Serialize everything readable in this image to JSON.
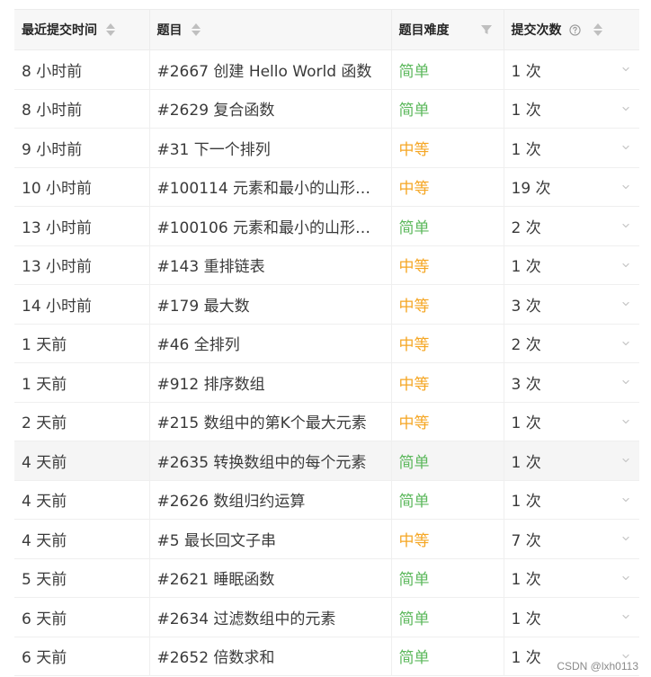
{
  "header": {
    "time": "最近提交时间",
    "title": "题目",
    "difficulty": "题目难度",
    "count": "提交次数"
  },
  "rows": [
    {
      "time": "8 小时前",
      "title": "#2667 创建 Hello World 函数",
      "difficulty": "简单",
      "level": "easy",
      "count": "1 次"
    },
    {
      "time": "8 小时前",
      "title": "#2629 复合函数",
      "difficulty": "简单",
      "level": "easy",
      "count": "1 次"
    },
    {
      "time": "9 小时前",
      "title": "#31 下一个排列",
      "difficulty": "中等",
      "level": "medium",
      "count": "1 次"
    },
    {
      "time": "10 小时前",
      "title": "#100114 元素和最小的山形三...",
      "difficulty": "中等",
      "level": "medium",
      "count": "19 次"
    },
    {
      "time": "13 小时前",
      "title": "#100106 元素和最小的山形三...",
      "difficulty": "简单",
      "level": "easy",
      "count": "2 次"
    },
    {
      "time": "13 小时前",
      "title": "#143 重排链表",
      "difficulty": "中等",
      "level": "medium",
      "count": "1 次"
    },
    {
      "time": "14 小时前",
      "title": "#179 最大数",
      "difficulty": "中等",
      "level": "medium",
      "count": "3 次"
    },
    {
      "time": "1 天前",
      "title": "#46 全排列",
      "difficulty": "中等",
      "level": "medium",
      "count": "2 次"
    },
    {
      "time": "1 天前",
      "title": "#912 排序数组",
      "difficulty": "中等",
      "level": "medium",
      "count": "3 次"
    },
    {
      "time": "2 天前",
      "title": "#215 数组中的第K个最大元素",
      "difficulty": "中等",
      "level": "medium",
      "count": "1 次"
    },
    {
      "time": "4 天前",
      "title": "#2635 转换数组中的每个元素",
      "difficulty": "简单",
      "level": "easy",
      "count": "1 次",
      "hover": true
    },
    {
      "time": "4 天前",
      "title": "#2626 数组归约运算",
      "difficulty": "简单",
      "level": "easy",
      "count": "1 次"
    },
    {
      "time": "4 天前",
      "title": "#5 最长回文子串",
      "difficulty": "中等",
      "level": "medium",
      "count": "7 次"
    },
    {
      "time": "5 天前",
      "title": "#2621 睡眠函数",
      "difficulty": "简单",
      "level": "easy",
      "count": "1 次"
    },
    {
      "time": "6 天前",
      "title": "#2634 过滤数组中的元素",
      "difficulty": "简单",
      "level": "easy",
      "count": "1 次"
    },
    {
      "time": "6 天前",
      "title": "#2652 倍数求和",
      "difficulty": "简单",
      "level": "easy",
      "count": "1 次"
    }
  ],
  "colors": {
    "easy": "#5cb85c",
    "medium": "#f5a623",
    "header_bg": "#f7f7f7"
  },
  "icons": {
    "sort": "sort-icon",
    "filter": "filter-icon",
    "help": "help-icon",
    "expand": "chevron-down-icon"
  },
  "watermark": "CSDN @lxh0113"
}
